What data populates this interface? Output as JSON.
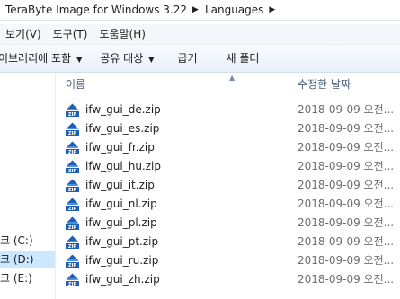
{
  "address": {
    "segments": [
      "TeraByte Image for Windows 3.22",
      "Languages"
    ]
  },
  "menu": {
    "items": [
      "보기(V)",
      "도구(T)",
      "도움말(H)"
    ]
  },
  "toolbar": {
    "library_label": "이브러리에 포함",
    "share_label": "공유 대상",
    "burn_label": "굽기",
    "new_folder_label": "새 폴더"
  },
  "nav": {
    "items": [
      {
        "label": "크 (C:)",
        "selected": false
      },
      {
        "label": "크 (D:)",
        "selected": true
      },
      {
        "label": "크 (E:)",
        "selected": false
      }
    ]
  },
  "columns": {
    "name": "이름",
    "date": "수정한 날짜"
  },
  "files": [
    {
      "name": "ifw_gui_de.zip",
      "date": "2018-09-09 오전..."
    },
    {
      "name": "ifw_gui_es.zip",
      "date": "2018-09-09 오전..."
    },
    {
      "name": "ifw_gui_fr.zip",
      "date": "2018-09-09 오전..."
    },
    {
      "name": "ifw_gui_hu.zip",
      "date": "2018-09-09 오전..."
    },
    {
      "name": "ifw_gui_it.zip",
      "date": "2018-09-09 오전..."
    },
    {
      "name": "ifw_gui_nl.zip",
      "date": "2018-09-09 오전..."
    },
    {
      "name": "ifw_gui_pl.zip",
      "date": "2018-09-09 오전..."
    },
    {
      "name": "ifw_gui_pt.zip",
      "date": "2018-09-09 오전..."
    },
    {
      "name": "ifw_gui_ru.zip",
      "date": "2018-09-09 오전..."
    },
    {
      "name": "ifw_gui_zh.zip",
      "date": "2018-09-09 오전..."
    }
  ],
  "icons": {
    "file": "zip-archive-icon",
    "crumb_separator": "chevron-right-icon",
    "dropdown": "chevron-down-icon"
  },
  "colors": {
    "selection": "#cce8ff",
    "header_text": "#4c607a",
    "date_text": "#6d6d6d",
    "zip_icon": "#1f5fb8"
  }
}
